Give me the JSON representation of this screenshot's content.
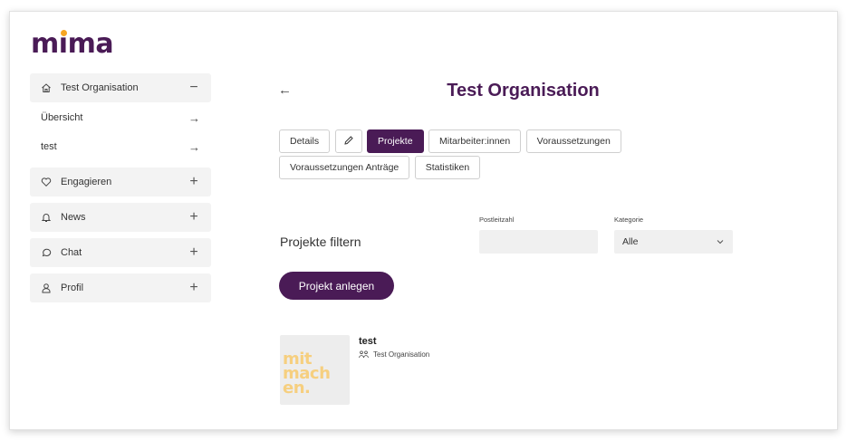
{
  "app": {
    "logo": "mima"
  },
  "sidebar": {
    "org": {
      "label": "Test Organisation",
      "sign": "−"
    },
    "sub_items": [
      {
        "label": "Übersicht",
        "arrow": "→"
      },
      {
        "label": "test",
        "arrow": "→"
      }
    ],
    "items": [
      {
        "label": "Engagieren",
        "icon": "heart-icon",
        "sign": "+"
      },
      {
        "label": "News",
        "icon": "bell-icon",
        "sign": "+"
      },
      {
        "label": "Chat",
        "icon": "chat-bubble-icon",
        "sign": "+"
      },
      {
        "label": "Profil",
        "icon": "user-icon",
        "sign": "+"
      }
    ]
  },
  "main": {
    "back": "←",
    "title": "Test Organisation",
    "tabs": [
      {
        "label": "Details"
      },
      {
        "label": "Projekte",
        "active": true
      },
      {
        "label": "Mitarbeiter:innen"
      },
      {
        "label": "Voraussetzungen"
      },
      {
        "label": "Voraussetzungen Anträge"
      },
      {
        "label": "Statistiken"
      }
    ],
    "filter": {
      "label": "Projekte filtern",
      "plz_label": "Postleitzahl",
      "plz_value": "",
      "category_label": "Kategorie",
      "category_value": "Alle"
    },
    "create_button": "Projekt anlegen",
    "projects": [
      {
        "name": "test",
        "org": "Test Organisation",
        "thumb_lines": [
          "mit",
          "mach",
          "en."
        ]
      }
    ]
  },
  "colors": {
    "brand": "#4a1b56",
    "accent": "#f6a623",
    "thumb_text": "#f6cf7f"
  }
}
